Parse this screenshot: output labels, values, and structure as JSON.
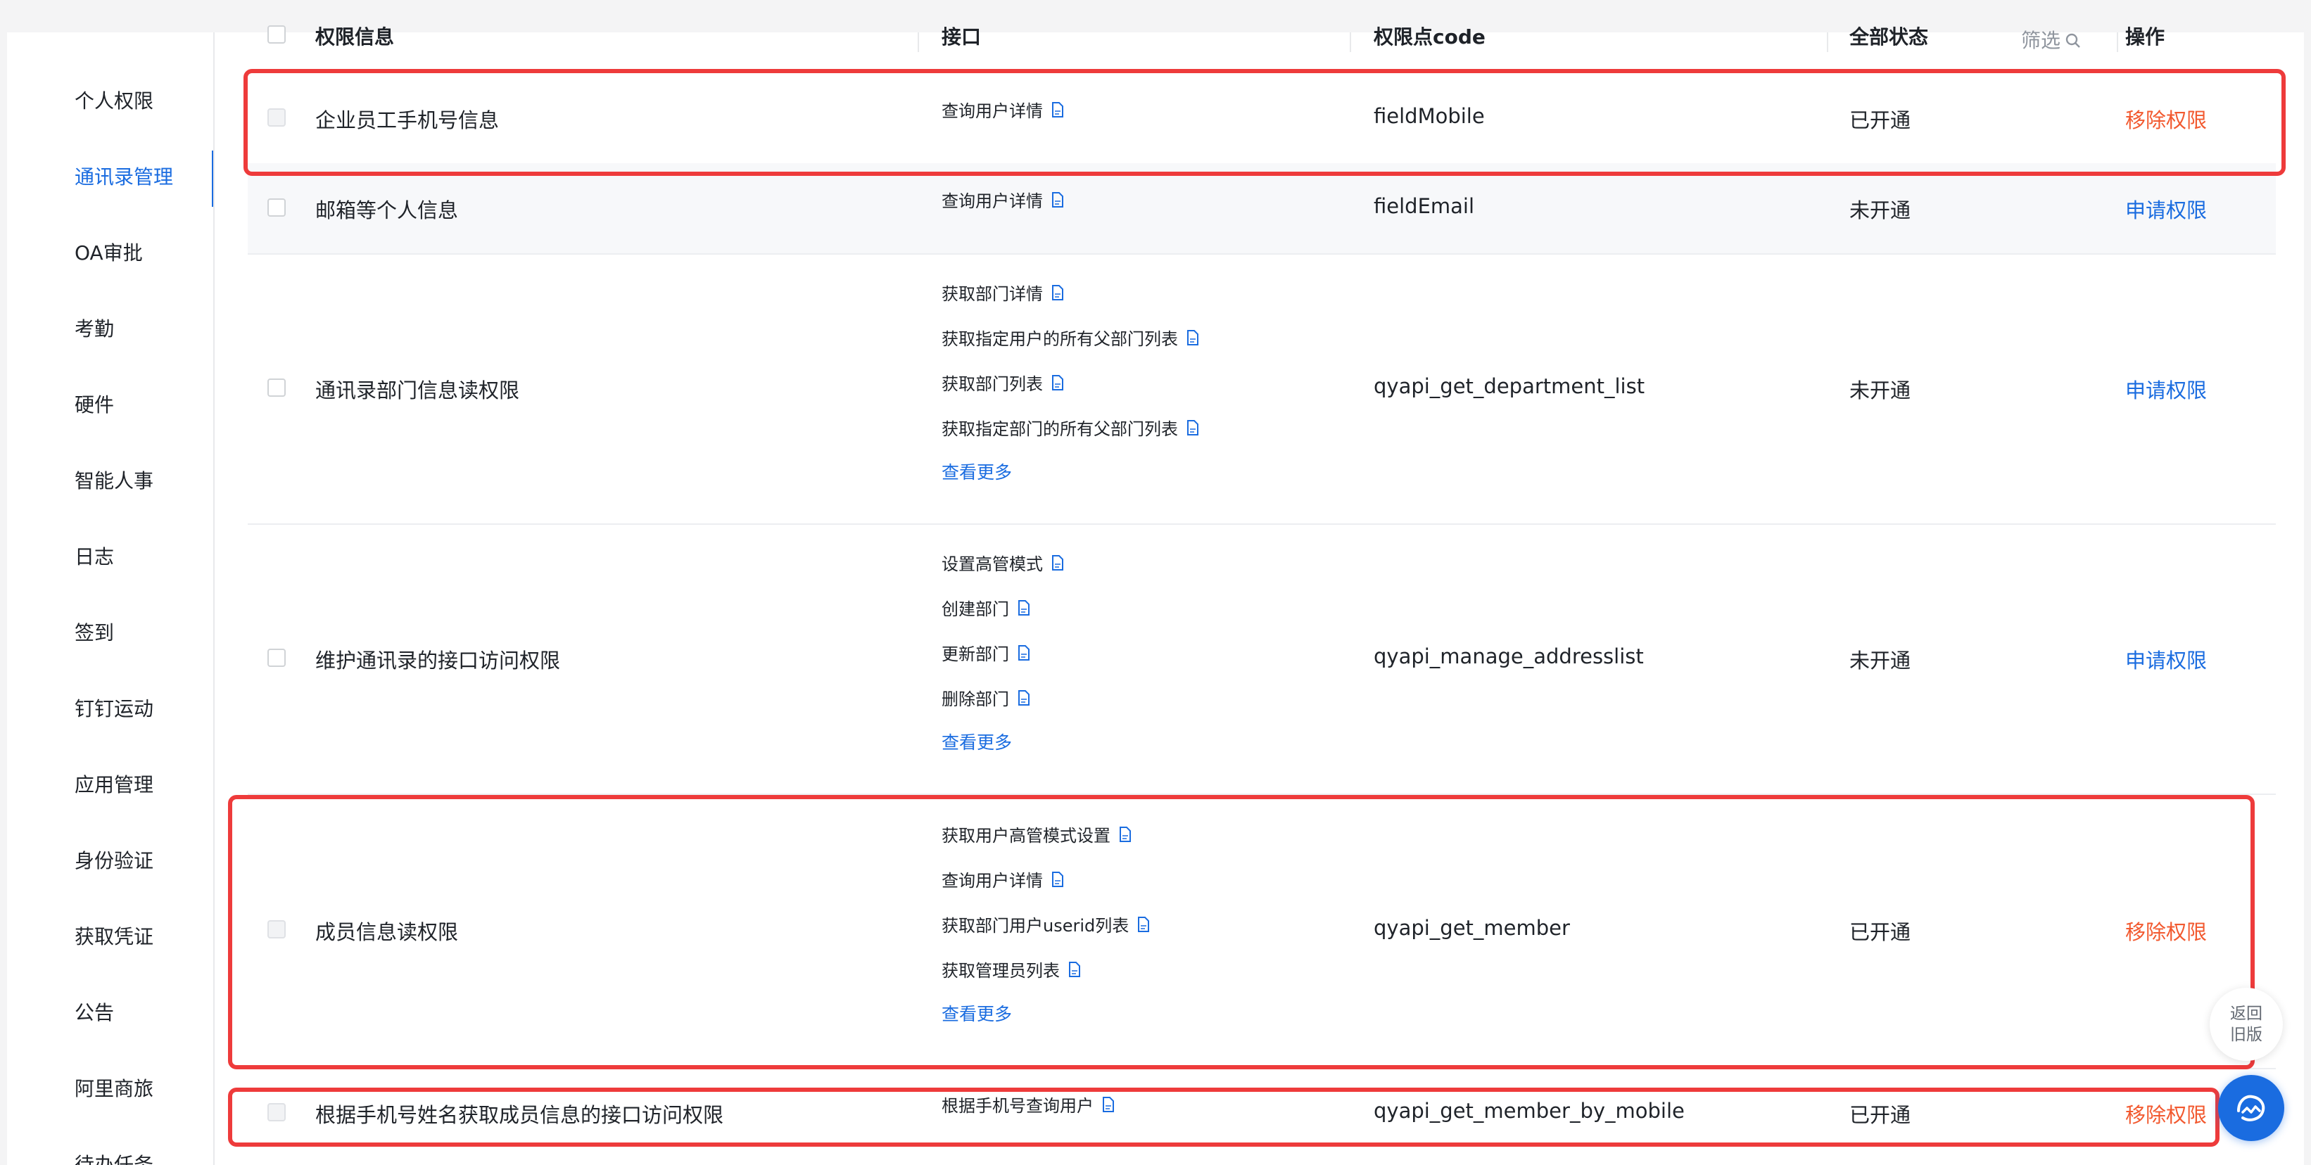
{
  "sidebar": {
    "items": [
      {
        "label": "个人权限",
        "active": false
      },
      {
        "label": "通讯录管理",
        "active": true
      },
      {
        "label": "OA审批",
        "active": false
      },
      {
        "label": "考勤",
        "active": false
      },
      {
        "label": "硬件",
        "active": false
      },
      {
        "label": "智能人事",
        "active": false
      },
      {
        "label": "日志",
        "active": false
      },
      {
        "label": "签到",
        "active": false
      },
      {
        "label": "钉钉运动",
        "active": false
      },
      {
        "label": "应用管理",
        "active": false
      },
      {
        "label": "身份验证",
        "active": false
      },
      {
        "label": "获取凭证",
        "active": false
      },
      {
        "label": "公告",
        "active": false
      },
      {
        "label": "阿里商旅",
        "active": false
      },
      {
        "label": "待办任务",
        "active": false
      }
    ]
  },
  "table": {
    "headers": {
      "name": "权限信息",
      "api": "接口",
      "code": "权限点code",
      "status": "全部状态",
      "filter": "筛选",
      "action": "操作"
    },
    "more_label": "查看更多",
    "rows": [
      {
        "name": "企业员工手机号信息",
        "apis": [
          "查询用户详情"
        ],
        "more": false,
        "code": "fieldMobile",
        "status": "已开通",
        "action": "移除权限",
        "action_type": "remove"
      },
      {
        "name": "邮箱等个人信息",
        "apis": [
          "查询用户详情"
        ],
        "more": false,
        "code": "fieldEmail",
        "status": "未开通",
        "action": "申请权限",
        "action_type": "apply"
      },
      {
        "name": "通讯录部门信息读权限",
        "apis": [
          "获取部门详情",
          "获取指定用户的所有父部门列表",
          "获取部门列表",
          "获取指定部门的所有父部门列表"
        ],
        "more": true,
        "code": "qyapi_get_department_list",
        "status": "未开通",
        "action": "申请权限",
        "action_type": "apply"
      },
      {
        "name": "维护通讯录的接口访问权限",
        "apis": [
          "设置高管模式",
          "创建部门",
          "更新部门",
          "删除部门"
        ],
        "more": true,
        "code": "qyapi_manage_addresslist",
        "status": "未开通",
        "action": "申请权限",
        "action_type": "apply"
      },
      {
        "name": "成员信息读权限",
        "apis": [
          "获取用户高管模式设置",
          "查询用户详情",
          "获取部门用户userid列表",
          "获取管理员列表"
        ],
        "more": true,
        "code": "qyapi_get_member",
        "status": "已开通",
        "action": "移除权限",
        "action_type": "remove"
      },
      {
        "name": "根据手机号姓名获取成员信息的接口访问权限",
        "apis": [
          "根据手机号查询用户"
        ],
        "more": false,
        "code": "qyapi_get_member_by_mobile",
        "status": "已开通",
        "action": "移除权限",
        "action_type": "remove"
      }
    ]
  },
  "floating": {
    "back_old_line1": "返回",
    "back_old_line2": "旧版"
  },
  "colors": {
    "primary": "#1a6ce0",
    "remove": "#f2592f",
    "highlight": "#ee3b3b"
  },
  "icons": {
    "api_doc": "document-icon",
    "filter": "search-icon",
    "bot": "assistant-bot-icon"
  }
}
